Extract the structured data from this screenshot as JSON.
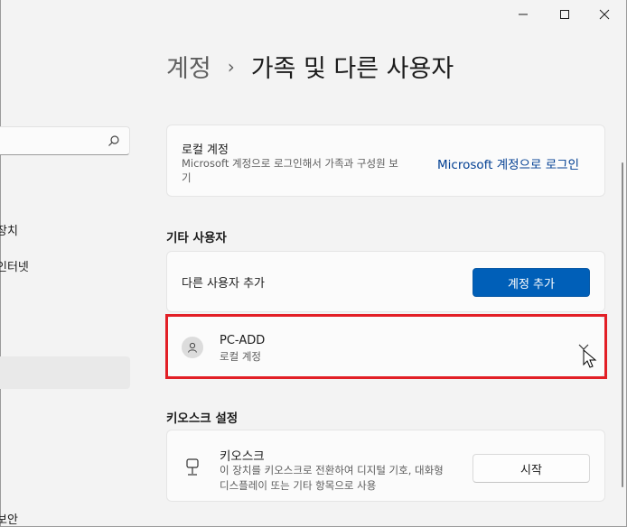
{
  "window": {
    "minimize_icon": "minimize-icon",
    "maximize_icon": "maximize-icon",
    "close_icon": "close-icon"
  },
  "sidebar": {
    "search_placeholder": "",
    "items": [
      {
        "label": "장치"
      },
      {
        "label": "인터넷"
      },
      {
        "label": ""
      },
      {
        "label": "보안"
      }
    ]
  },
  "breadcrumb": {
    "parent": "계정",
    "separator": "›",
    "current": "가족 및 다른 사용자"
  },
  "local_account": {
    "title": "로컬 계정",
    "description": "Microsoft 계정으로 로그인해서 가족과 구성원 보기",
    "link": "Microsoft 계정으로 로그인"
  },
  "other_users": {
    "section_title": "기타 사용자",
    "add_label": "다른 사용자 추가",
    "add_button": "계정 추가",
    "user": {
      "name": "PC-ADD",
      "type": "로컬 계정"
    }
  },
  "kiosk": {
    "section_title": "키오스크 설정",
    "title": "키오스크",
    "description": "이 장치를 키오스크로 전환하여 디지털 기호, 대화형 디스플레이 또는 기타 항목으로 사용",
    "button": "시작"
  },
  "colors": {
    "accent": "#005fb8",
    "highlight_border": "#e21f26",
    "link": "#003e92"
  }
}
